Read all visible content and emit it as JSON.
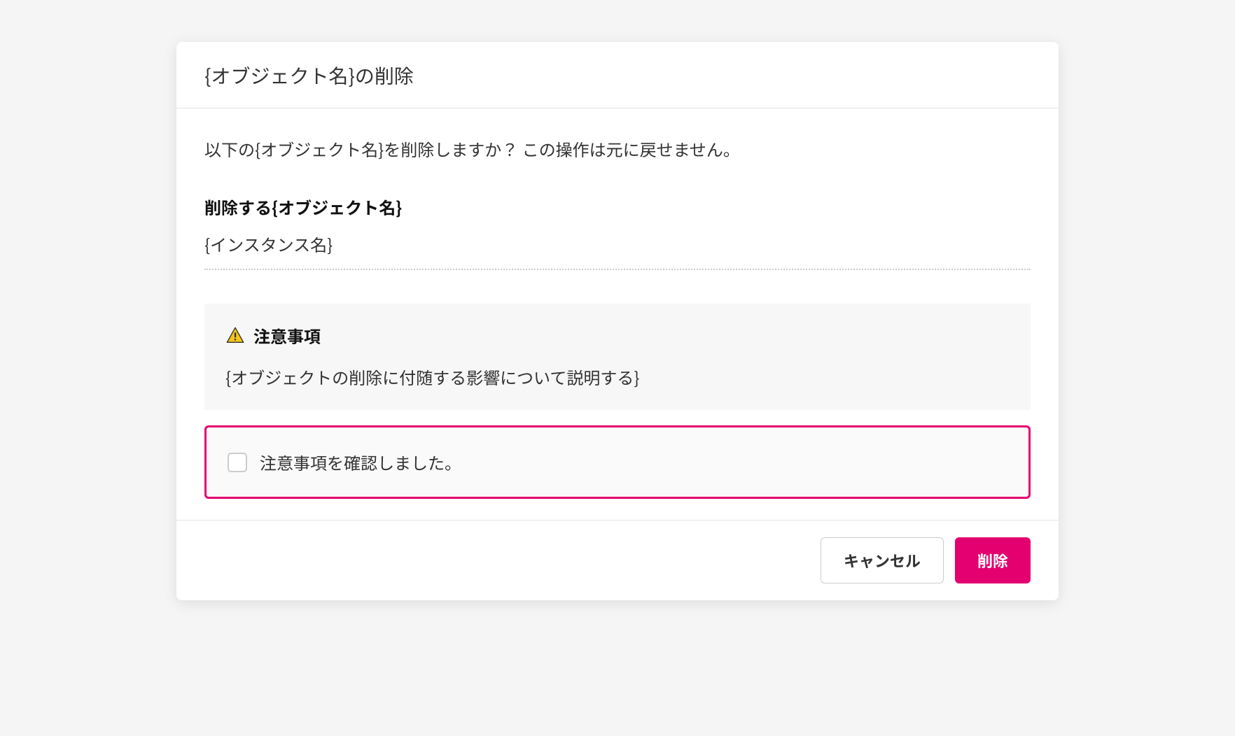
{
  "dialog": {
    "title": "{オブジェクト名}の削除",
    "confirm_text": "以下の{オブジェクト名}を削除しますか？ この操作は元に戻せません。",
    "section_label": "削除する{オブジェクト名}",
    "instance_name": "{インスタンス名}",
    "notice": {
      "title": "注意事項",
      "description": "{オブジェクトの削除に付随する影響について説明する}"
    },
    "checkbox_label": "注意事項を確認しました。",
    "buttons": {
      "cancel": "キャンセル",
      "delete": "削除"
    }
  },
  "colors": {
    "accent": "#e4006f",
    "warning": "#f5c518"
  }
}
